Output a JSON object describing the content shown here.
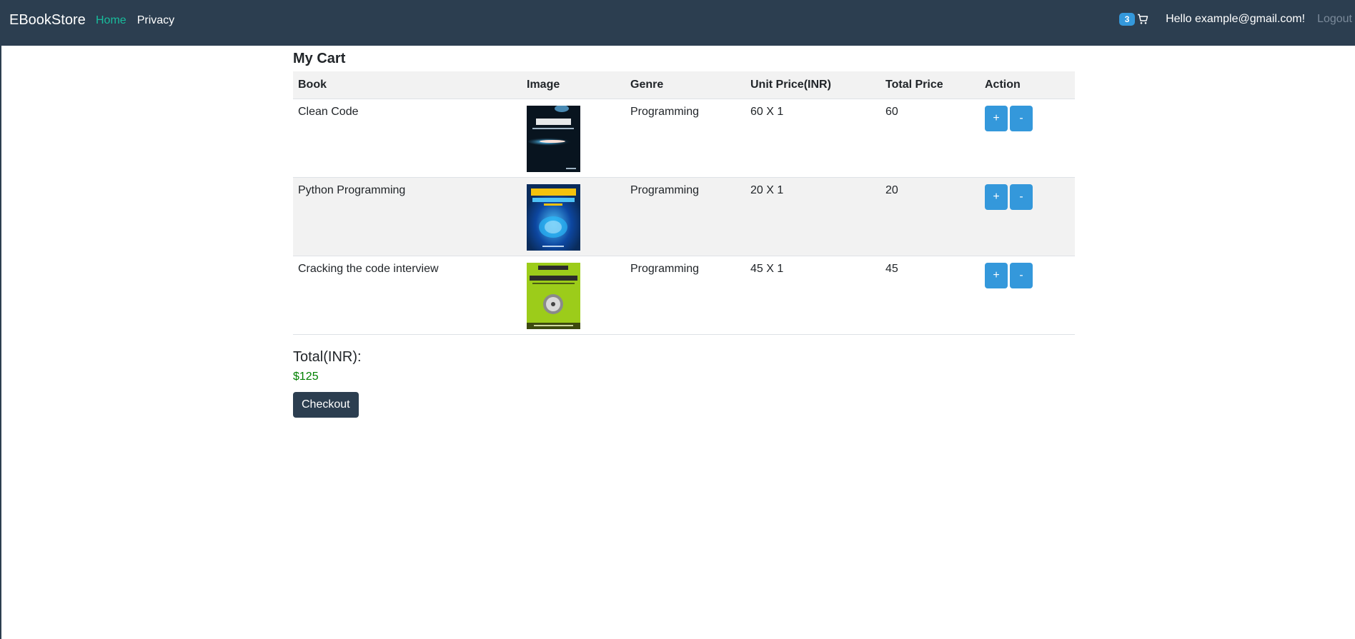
{
  "nav": {
    "brand": "EBookStore",
    "links": [
      {
        "label": "Home",
        "active": true
      },
      {
        "label": "Privacy",
        "active": false
      }
    ],
    "cart_count": "3",
    "greeting": "Hello example@gmail.com!",
    "logout": "Logout"
  },
  "cart": {
    "title": "My Cart",
    "columns": [
      "Book",
      "Image",
      "Genre",
      "Unit Price(INR)",
      "Total Price",
      "Action"
    ],
    "rows": [
      {
        "book": "Clean Code",
        "genre": "Programming",
        "unit_price": "60 X 1",
        "total": "60",
        "plus": "+",
        "minus": "-",
        "cover": {
          "icon": "clean-code-cover"
        }
      },
      {
        "book": "Python Programming",
        "genre": "Programming",
        "unit_price": "20 X 1",
        "total": "20",
        "plus": "+",
        "minus": "-",
        "cover": {
          "icon": "python-programming-cover"
        }
      },
      {
        "book": "Cracking the code interview",
        "genre": "Programming",
        "unit_price": "45 X 1",
        "total": "45",
        "plus": "+",
        "minus": "-",
        "cover": {
          "icon": "cracking-coding-interview-cover"
        }
      }
    ],
    "total_label": "Total(INR):",
    "total_value": "$125",
    "checkout_label": "Checkout"
  },
  "colors": {
    "navbar": "#2c3e50",
    "active_link": "#18bc9c",
    "accent": "#3498db",
    "total": "#008000"
  }
}
